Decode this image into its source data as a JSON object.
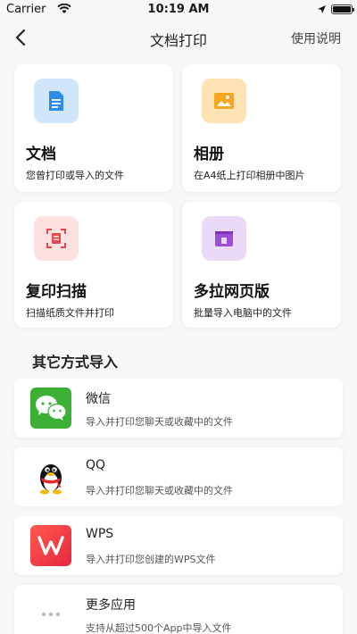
{
  "status_bar": {
    "carrier": "Carrier",
    "time": "10:19 AM",
    "battery_level": 1.0
  },
  "nav": {
    "title": "文档打印",
    "right_action": "使用说明"
  },
  "cards": [
    {
      "title": "文档",
      "subtitle": "您曾打印或导入的文件",
      "icon": "document-icon",
      "color": "#cfe6fb"
    },
    {
      "title": "相册",
      "subtitle": "在A4纸上打印相册中图片",
      "icon": "photo-icon",
      "color": "#fde3b4"
    },
    {
      "title": "复印扫描",
      "subtitle": "扫描纸质文件并打印",
      "icon": "scan-icon",
      "color": "#fde0e0"
    },
    {
      "title": "多拉网页版",
      "subtitle": "批量导入电脑中的文件",
      "icon": "folder-icon",
      "color": "#ead9f7"
    }
  ],
  "section": {
    "title": "其它方式导入"
  },
  "imports": [
    {
      "title": "微信",
      "subtitle": "导入并打印您聊天或收藏中的文件",
      "icon": "wechat-icon",
      "color": "#3cb034"
    },
    {
      "title": "QQ",
      "subtitle": "导入并打印您聊天或收藏中的文件",
      "icon": "qq-penguin-icon",
      "color": "#ffffff"
    },
    {
      "title": "WPS",
      "subtitle": "导入并打印您创建的WPS文件",
      "icon": "wps-icon",
      "color": "#f0333f"
    },
    {
      "title": "更多应用",
      "subtitle": "支持从超过500个App中导入文件",
      "icon": "more-dots-icon",
      "color": "#ffffff"
    }
  ]
}
